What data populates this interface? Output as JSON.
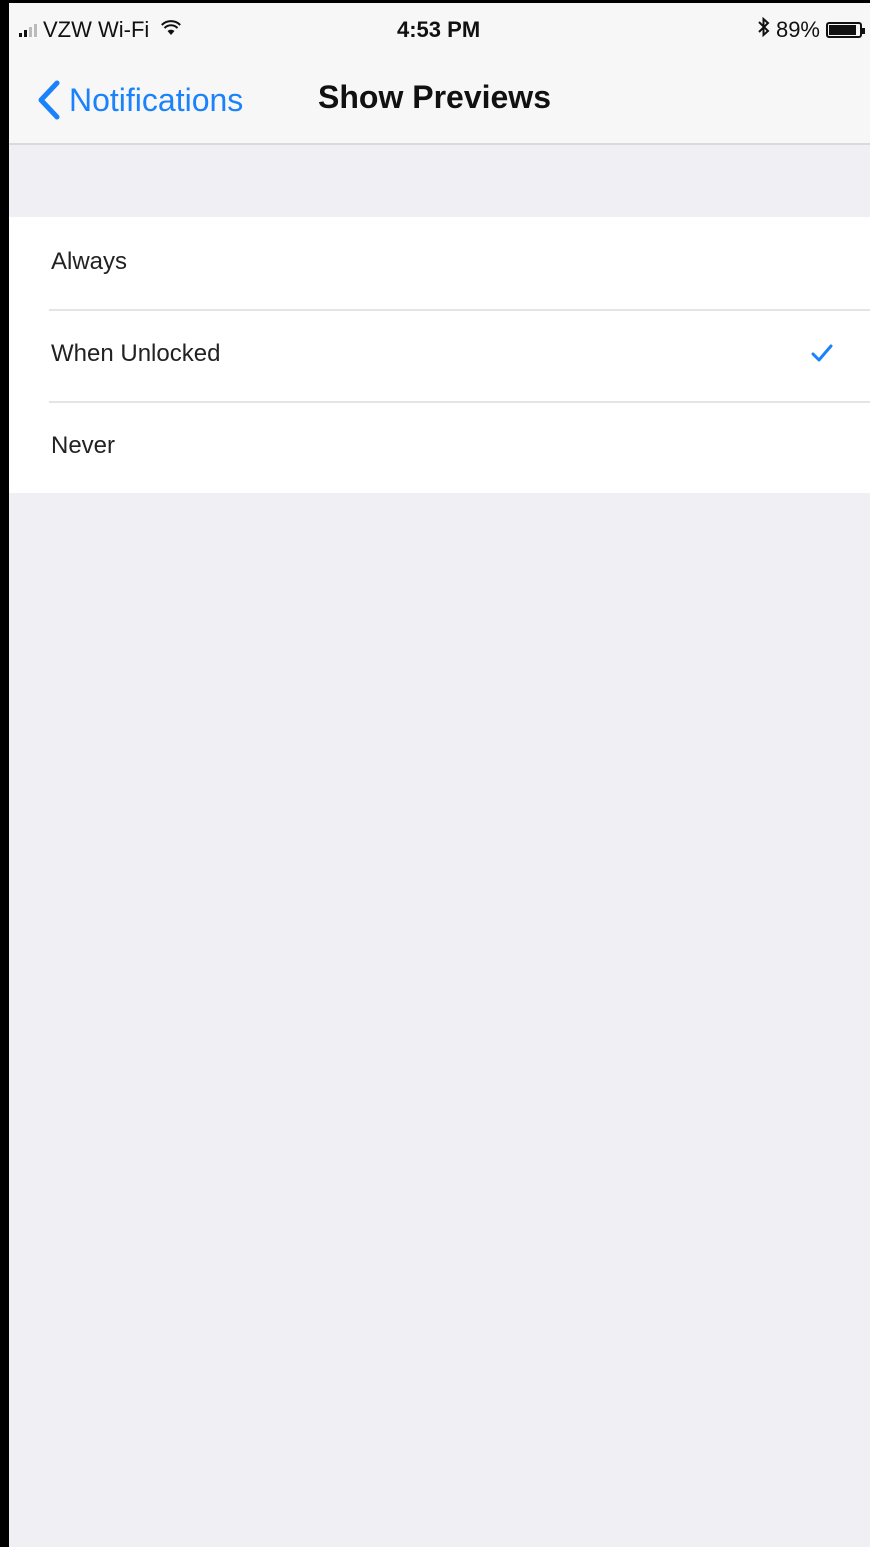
{
  "status_bar": {
    "carrier": "VZW Wi-Fi",
    "signal_icon": "signal-bars-icon",
    "wifi_icon": "wifi-icon",
    "time": "4:53 PM",
    "bluetooth_icon": "bluetooth-icon",
    "battery_percent": "89%",
    "battery_level": 0.89
  },
  "nav": {
    "back_label": "Notifications",
    "back_icon": "chevron-left-icon",
    "title": "Show Previews"
  },
  "options": [
    {
      "label": "Always",
      "selected": false
    },
    {
      "label": "When Unlocked",
      "selected": true
    },
    {
      "label": "Never",
      "selected": false
    }
  ],
  "colors": {
    "accent": "#1a82fb",
    "background": "#efeff4",
    "cell_background": "#ffffff"
  }
}
